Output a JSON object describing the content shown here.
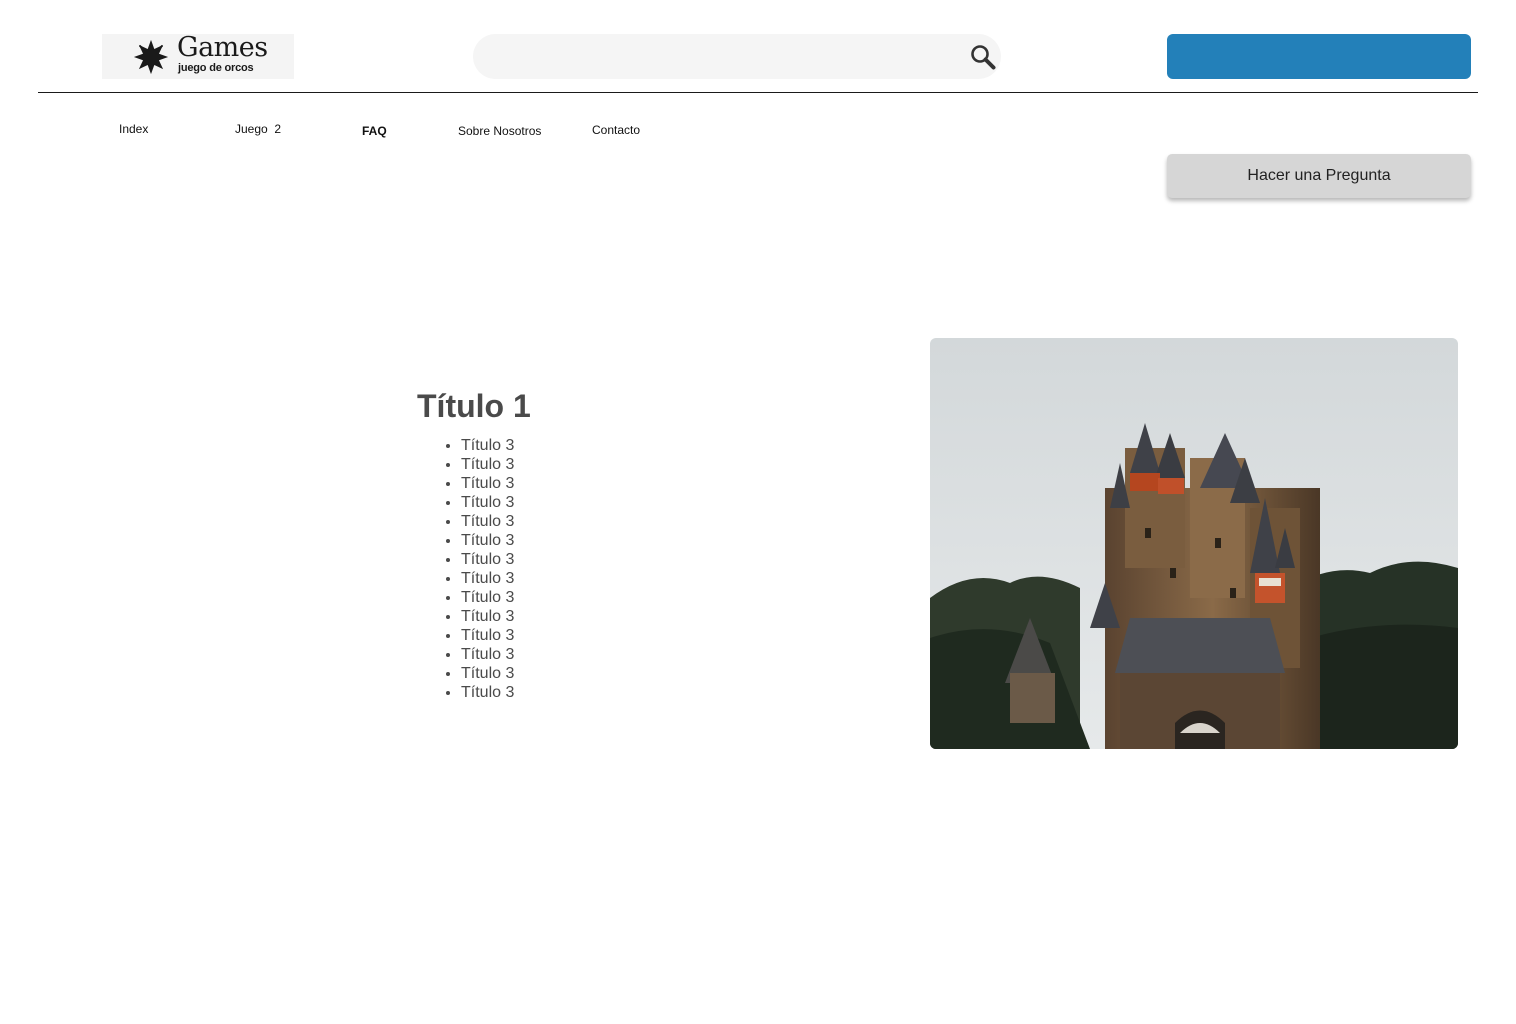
{
  "header": {
    "logo": {
      "title": "Games",
      "subtitle": "juego de orcos",
      "icon": "flower-logo-icon"
    },
    "search": {
      "placeholder": "",
      "value": "",
      "icon": "search-icon"
    },
    "top_button": {
      "label": "",
      "color": "#2380b9"
    }
  },
  "nav": {
    "items": [
      {
        "label": "Index",
        "active": false
      },
      {
        "label": "Juego  2",
        "active": false
      },
      {
        "label": "FAQ",
        "active": true
      },
      {
        "label": "Sobre Nosotros",
        "active": false
      },
      {
        "label": "Contacto",
        "active": false
      }
    ]
  },
  "ask_button": {
    "label": "Hacer una Pregunta"
  },
  "main": {
    "title": "Título 1",
    "topics": [
      "Título 3",
      "Título 3",
      "Título 3",
      "Título 3",
      "Título 3",
      "Título 3",
      "Título 3",
      "Título 3",
      "Título 3",
      "Título 3",
      "Título 3",
      "Título 3",
      "Título 3",
      "Título 3"
    ],
    "image": {
      "subject": "castle-photo"
    }
  }
}
